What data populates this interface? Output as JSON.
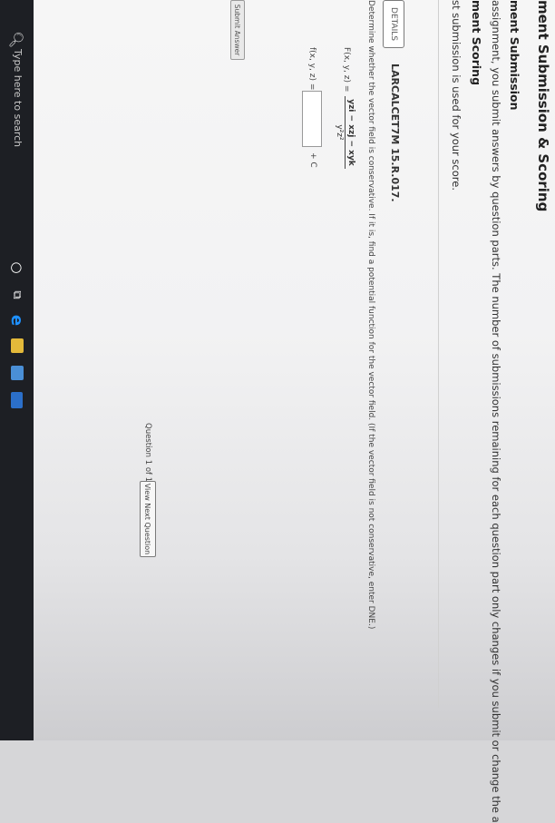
{
  "taskbar": {
    "search_placeholder": "Type here to search",
    "search_icon": "🔍︎",
    "cortana_icon": "○",
    "taskview_icon": "⧉",
    "edge_icon": "e"
  },
  "page": {
    "title": "ment Submission & Scoring",
    "submission_heading": "ment Submission",
    "submission_text": "assignment, you submit answers by question parts. The number of submissions remaining for each question part only changes if you submit or change the a",
    "scoring_heading": "ment Scoring",
    "scoring_text": "st submission is used for your score."
  },
  "question": {
    "details_label": "DETAILS",
    "code": "LARCALCET7M 15.R.017.",
    "prompt": "Determine whether the vector field is conservative. If it is, find a potential function for the vector field. (If the vector field is not conservative, enter DNE.)",
    "field_label": "F(x, y, z) =",
    "numerator": "yzi − xzj − xyk",
    "denominator": "y²z²",
    "answer_label": "f(x, y, z) =",
    "answer_value": "",
    "constant": "+ C",
    "submit_label": "Submit Answer"
  },
  "footer": {
    "question_count": "Question 1 of 13",
    "next_label": "View Next Question"
  },
  "colors": {
    "taskbar": "#1d1f24",
    "page_background": "#f6f6f6",
    "edge_blue": "#1e90ff"
  }
}
